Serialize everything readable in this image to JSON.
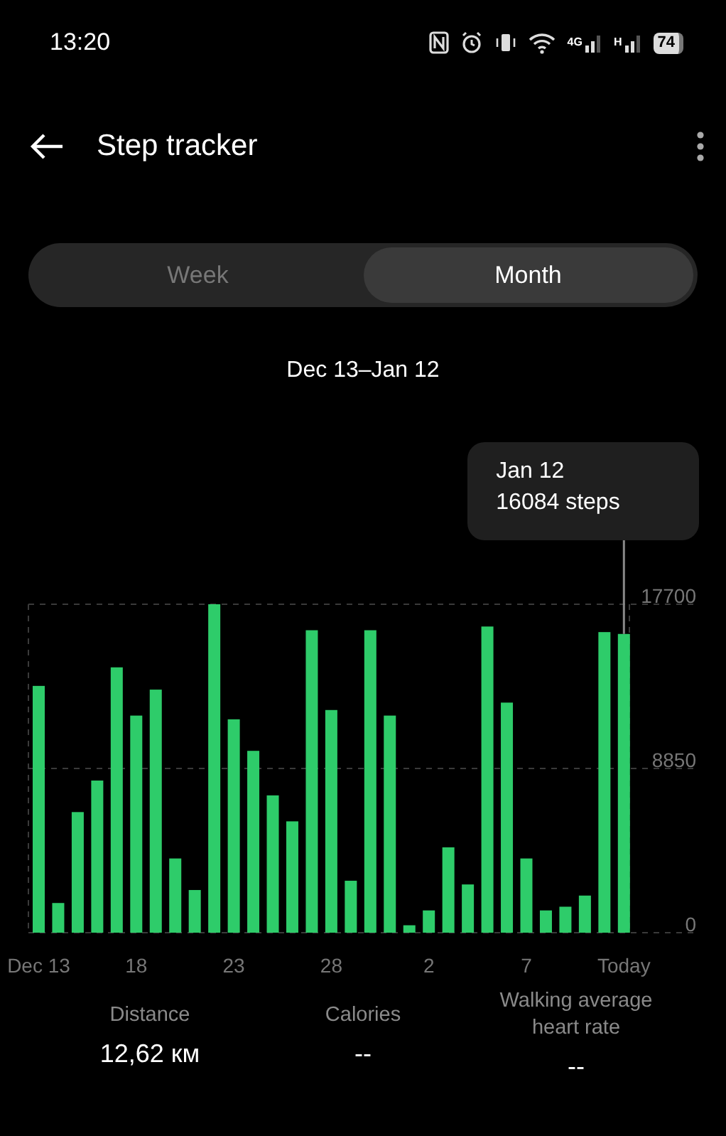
{
  "status_bar": {
    "time": "13:20",
    "battery": "74",
    "network_1": "4G",
    "network_2": "H"
  },
  "header": {
    "title": "Step tracker"
  },
  "tabs": [
    {
      "label": "Week",
      "selected": false
    },
    {
      "label": "Month",
      "selected": true
    }
  ],
  "range": "Dec 13–Jan 12",
  "chart": {
    "tooltip": {
      "date": "Jan 12",
      "steps": "16084 steps"
    },
    "chart_data": {
      "type": "bar",
      "categories": [
        "Dec 13",
        null,
        null,
        null,
        null,
        "18",
        null,
        null,
        null,
        null,
        "23",
        null,
        null,
        null,
        null,
        "28",
        null,
        null,
        null,
        null,
        "2",
        null,
        null,
        null,
        null,
        "7",
        null,
        null,
        null,
        null,
        "Today"
      ],
      "series": [
        {
          "color": "#2ecc6a",
          "values": [
            13300,
            1600,
            6500,
            8200,
            14300,
            11700,
            13100,
            4000,
            2300,
            17700,
            11500,
            9800,
            7400,
            6000,
            16300,
            12000,
            2800,
            16300,
            11700,
            400,
            1200,
            4600,
            2600,
            16500,
            12400,
            4000,
            1200,
            1400,
            2000,
            16200,
            16100
          ]
        }
      ],
      "ylim": [
        0,
        17700
      ],
      "yticks": [
        0,
        8850,
        17700
      ]
    }
  },
  "stats": [
    {
      "label": "Distance",
      "value": "12,62 км"
    },
    {
      "label": "Calories",
      "value": "--"
    },
    {
      "label": "Walking average heart rate",
      "value": "--"
    }
  ]
}
